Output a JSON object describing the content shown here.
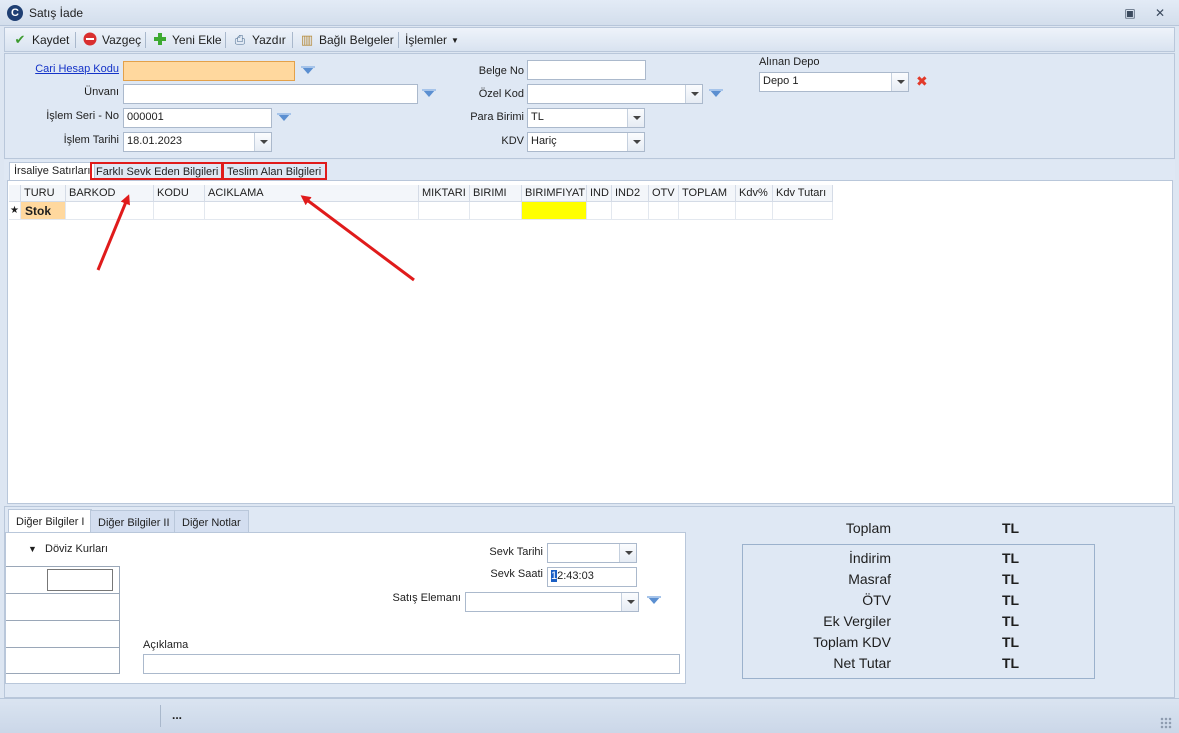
{
  "window": {
    "title": "Satış İade",
    "logo": "C"
  },
  "colors": {
    "highlight_yellow": "#ffff00",
    "input_active": "#ffd89e",
    "annotation_red": "#e01b1b",
    "link_blue": "#1433c8"
  },
  "toolbar": {
    "save_label": "Kaydet",
    "cancel_label": "Vazgeç",
    "new_label": "Yeni Ekle",
    "print_label": "Yazdır",
    "docs_label": "Bağlı Belgeler",
    "ops_label": "İşlemler",
    "icons": [
      "check-icon",
      "cancel-icon",
      "add-icon",
      "print-icon",
      "documents-icon",
      "dropdown-arrow-icon"
    ]
  },
  "header": {
    "cari_label": "Cari Hesap Kodu",
    "cari_value": "",
    "unvan_label": "Ünvanı",
    "unvan_value": "",
    "seri_label": "İşlem  Seri - No",
    "seri_value": "000001",
    "tarih_label": "İşlem Tarihi",
    "tarih_value": "18.01.2023",
    "belge_label": "Belge No",
    "belge_value": "",
    "ozel_label": "Özel Kod",
    "ozel_value": "",
    "para_label": "Para Birimi",
    "para_value": "TL",
    "kdv_label": "KDV",
    "kdv_value": "Hariç",
    "depo_label": "Alınan Depo",
    "depo_value": "Depo 1"
  },
  "tabs": [
    {
      "label": "İrsaliye Satırları"
    },
    {
      "label": "Farklı Sevk Eden Bilgileri"
    },
    {
      "label": "Teslim Alan Bilgileri"
    }
  ],
  "grid": {
    "columns": [
      "TURU",
      "BARKOD",
      "KODU",
      "ACIKLAMA",
      "MIKTARI",
      "BIRIMI",
      "BIRIMFIYAT",
      "IND",
      "IND2",
      "OTV",
      "TOPLAM",
      "Kdv%",
      "Kdv Tutarı"
    ],
    "new_row_marker": "★",
    "new_row_type": "Stok"
  },
  "bottom_tabs": [
    {
      "label": "Diğer Bilgiler I"
    },
    {
      "label": "Diğer Bilgiler II"
    },
    {
      "label": "Diğer Notlar"
    }
  ],
  "bottom": {
    "doviz_label": "Döviz Kurları",
    "sevk_tarihi_label": "Sevk Tarihi",
    "sevk_tarihi_value": "",
    "sevk_saati_label": "Sevk Saati",
    "sevk_saati_cursor": "1",
    "sevk_saati_value": "2:43:03",
    "satis_label": "Satış Elemanı",
    "satis_value": "",
    "aciklama_label": "Açıklama",
    "aciklama_value": ""
  },
  "totals": {
    "toplam_label": "Toplam",
    "toplam_value": "TL",
    "rows": [
      {
        "label": "İndirim",
        "value": "TL"
      },
      {
        "label": "Masraf",
        "value": "TL"
      },
      {
        "label": "ÖTV",
        "value": "TL"
      },
      {
        "label": "Ek Vergiler",
        "value": "TL"
      },
      {
        "label": "Toplam KDV",
        "value": "TL"
      },
      {
        "label": "Net Tutar",
        "value": "TL"
      }
    ]
  },
  "status": {
    "text": "..."
  }
}
